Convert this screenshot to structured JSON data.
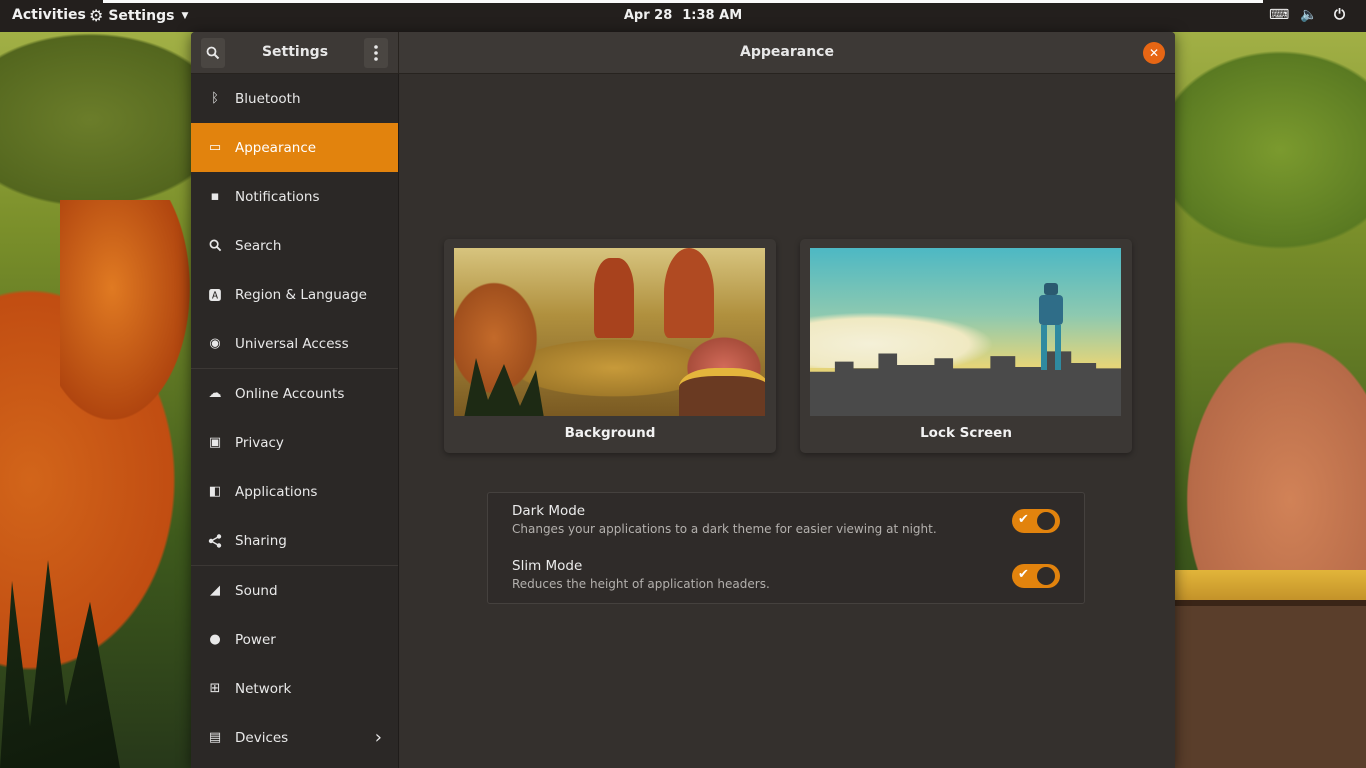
{
  "top_panel": {
    "activities": "Activities",
    "app_menu": "Settings",
    "date": "Apr 28",
    "time": "1:38 AM"
  },
  "window": {
    "sidebar_title": "Settings",
    "main_title": "Appearance"
  },
  "sidebar": {
    "items": [
      {
        "label": "Bluetooth",
        "icon": "bluetooth-icon"
      },
      {
        "label": "Appearance",
        "icon": "display-icon"
      },
      {
        "label": "Notifications",
        "icon": "notifications-icon"
      },
      {
        "label": "Search",
        "icon": "search-icon"
      },
      {
        "label": "Region & Language",
        "icon": "region-icon"
      },
      {
        "label": "Universal Access",
        "icon": "accessibility-icon"
      },
      {
        "label": "Online Accounts",
        "icon": "cloud-icon"
      },
      {
        "label": "Privacy",
        "icon": "privacy-icon"
      },
      {
        "label": "Applications",
        "icon": "applications-icon"
      },
      {
        "label": "Sharing",
        "icon": "share-icon"
      },
      {
        "label": "Sound",
        "icon": "sound-icon"
      },
      {
        "label": "Power",
        "icon": "power-icon"
      },
      {
        "label": "Network",
        "icon": "network-icon"
      },
      {
        "label": "Devices",
        "icon": "devices-icon"
      }
    ],
    "active_item": "Appearance"
  },
  "main": {
    "cards": [
      {
        "label": "Background"
      },
      {
        "label": "Lock Screen"
      }
    ],
    "settings": [
      {
        "title": "Dark Mode",
        "description": "Changes your applications to a dark theme for easier viewing at night.",
        "enabled": true
      },
      {
        "title": "Slim Mode",
        "description": "Reduces the height of application headers.",
        "enabled": true
      }
    ]
  },
  "colors": {
    "accent": "#e2830d",
    "close_button": "#e76614",
    "window_bg": "#34302d",
    "sidebar_bg": "#2b2826",
    "panel_bg": "#231f1d"
  }
}
